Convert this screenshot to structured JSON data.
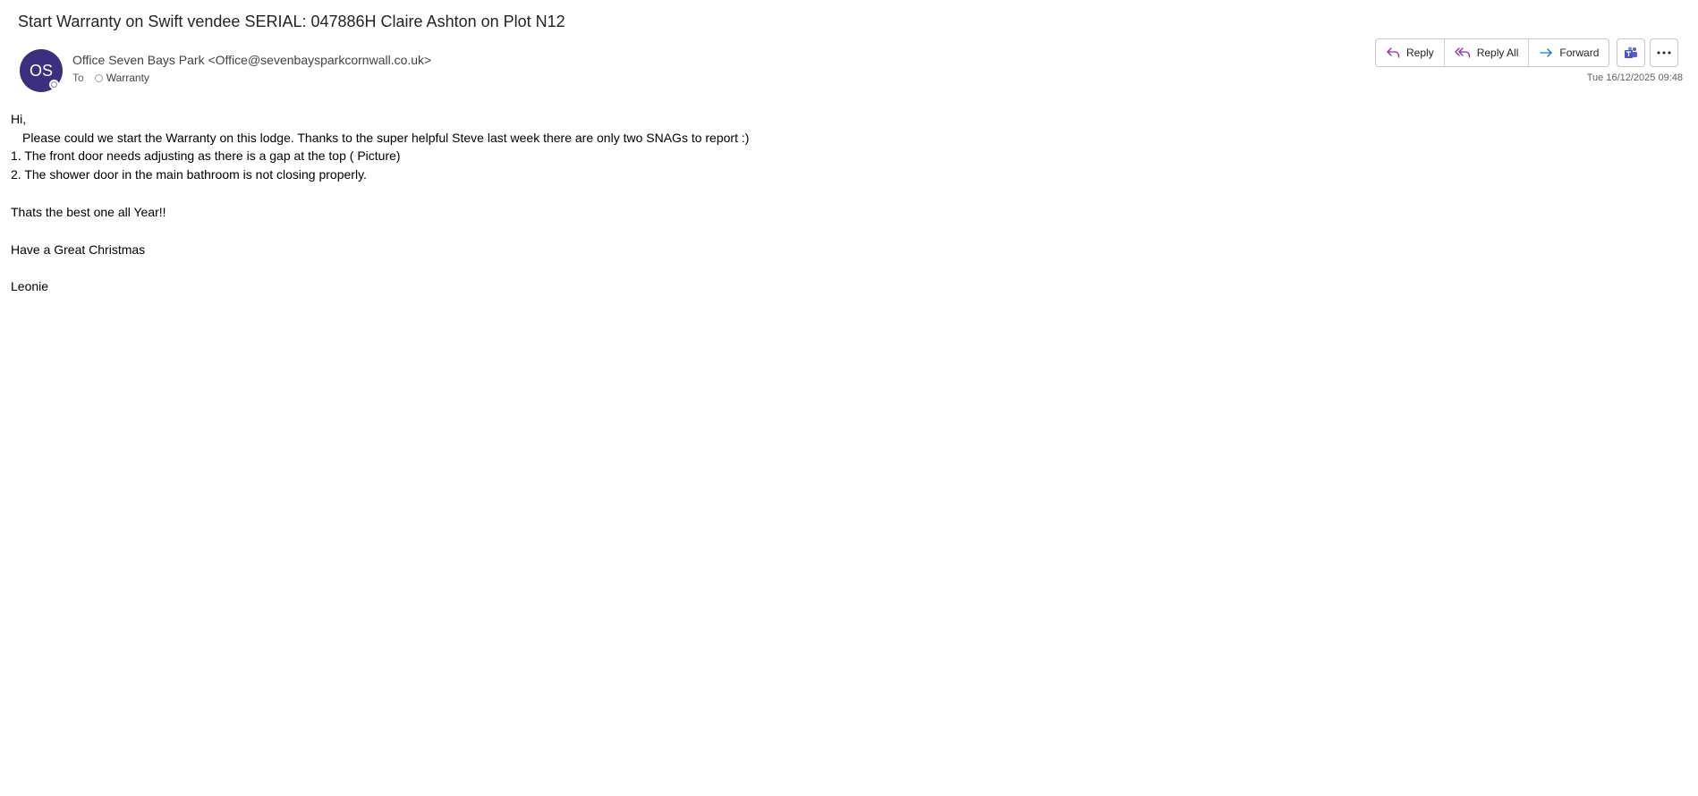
{
  "email": {
    "subject": "Start Warranty on Swift vendee SERIAL: 047886H Claire Ashton on Plot N12",
    "avatar_initials": "OS",
    "avatar_color": "#3b2f7e",
    "from": "Office Seven Bays Park <Office@sevenbaysparkcornwall.co.uk>",
    "to_label": "To",
    "to_recipient": "Warranty",
    "date": "Tue 16/12/2025 09:48"
  },
  "actions": {
    "reply_label": "Reply",
    "reply_all_label": "Reply All",
    "forward_label": "Forward",
    "reply_icon_color": "#8b2fa8",
    "forward_icon_color": "#1c73c8",
    "teams_icon": "teams-icon",
    "more_icon": "more-icon"
  },
  "body": {
    "greeting": "Hi,",
    "line1": "Please could we start the Warranty on this lodge. Thanks to the super helpful Steve last week there are only two SNAGs to report :)",
    "item1": "1. The front door needs adjusting as there is a gap at the top ( Picture)",
    "item2": "2. The shower door in the main bathroom is not closing properly.",
    "line2": "Thats the best one all Year!!",
    "line3": "Have a Great Christmas",
    "signature": "Leonie"
  }
}
